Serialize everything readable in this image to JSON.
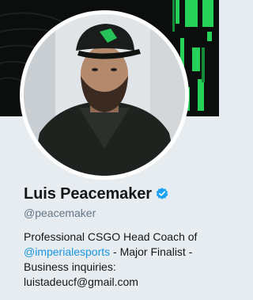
{
  "profile": {
    "display_name": "Luis Peacemaker",
    "verified": true,
    "verified_icon": "verified-badge-icon",
    "handle": "@peacemaker",
    "bio": {
      "line1": "Professional CSGO Head Coach of",
      "mention": "@imperialesports",
      "line2_rest": " - Major Finalist -",
      "line3": "Business inquiries:",
      "line4": "luistadeucf@gmail.com"
    }
  },
  "colors": {
    "name": "#14171a",
    "handle": "#657786",
    "mention": "#1b95e0",
    "verified": "#1da1f2",
    "banner_accent": "#27d35a",
    "background": "#e6ecf0"
  }
}
